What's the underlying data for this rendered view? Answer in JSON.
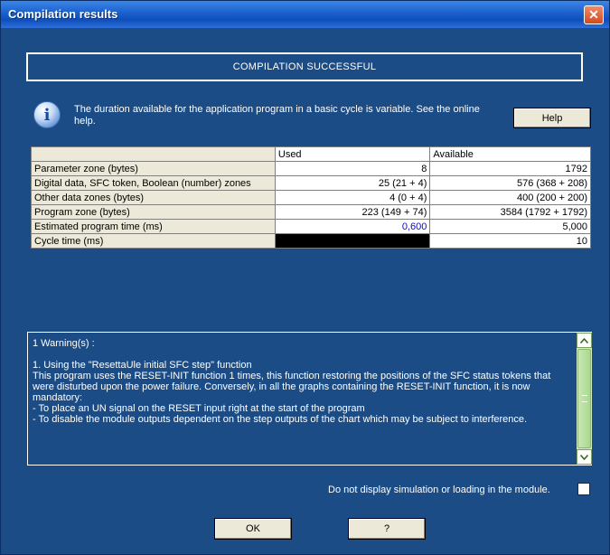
{
  "window": {
    "title": "Compilation results",
    "close_glyph": "✕"
  },
  "banner": {
    "text": "COMPILATION SUCCESSFUL"
  },
  "info": {
    "icon": "info-icon",
    "icon_glyph": "i",
    "text": "The duration available for the application program in a basic cycle is variable.  See the online help.",
    "help_label": "Help"
  },
  "table": {
    "headers": [
      "",
      "Used",
      "Available"
    ],
    "rows": [
      {
        "label": "Parameter zone (bytes)",
        "used": "8",
        "available": "1792"
      },
      {
        "label": "Digital data, SFC token, Boolean (number) zones",
        "used": "25 (21 + 4)",
        "available": "576 (368 + 208)"
      },
      {
        "label": "Other data zones (bytes)",
        "used": "4 (0 + 4)",
        "available": "400 (200 + 200)"
      },
      {
        "label": "Program zone (bytes)",
        "used": "223 (149 + 74)",
        "available": "3584 (1792 + 1792)"
      },
      {
        "label": "Estimated program time (ms)",
        "used": "0,600",
        "available": "5,000"
      },
      {
        "label": "Cycle time (ms)",
        "used": "",
        "available": "10"
      }
    ]
  },
  "warnings": {
    "heading": "1 Warning(s) :",
    "item_title": "1. Using the \"ResettaUle initial SFC step\" function",
    "body": "This program uses the RESET-INIT function 1 times, this function restoring the positions of the SFC status tokens that were disturbed upon the power failure. Conversely, in all the graphs containing the RESET-INIT function, it is now mandatory:",
    "bullet1": "- To place an UN signal on the RESET input right at the start of the program",
    "bullet2": "- To disable the module outputs dependent on the step outputs of the chart which may be subject to interference."
  },
  "footer": {
    "checkbox_label": "Do not display simulation or loading in the module.",
    "checkbox_checked": false,
    "ok_label": "OK",
    "second_label": "?"
  },
  "colors": {
    "background": "#1b4c86",
    "titlebar": "#1a5fcc",
    "close": "#d34a1e",
    "estimated_value": "#0000ff"
  }
}
